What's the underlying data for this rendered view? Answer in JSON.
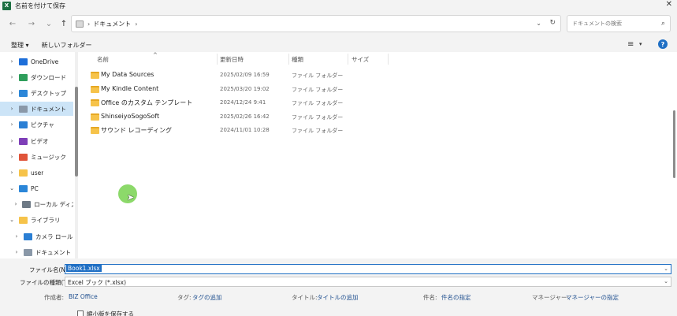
{
  "titlebar": {
    "app_icon": "X",
    "title": "名前を付けて保存",
    "close": "✕"
  },
  "navbar": {
    "back": "←",
    "forward": "→",
    "recent": "⌄",
    "up": "↑",
    "sep": "›",
    "crumb": "ドキュメント",
    "crumb_sep": "›",
    "dropdown": "⌄",
    "refresh": "↻",
    "search_placeholder": "ドキュメントの検索",
    "search_icon": "⌕"
  },
  "toolbar": {
    "organize": "整理 ▾",
    "new_folder": "新しいフォルダー",
    "view_icon": "≡",
    "view_drop": "▾",
    "help": "?"
  },
  "nav_pane": {
    "items": [
      {
        "chev": "›",
        "label": "OneDrive",
        "icon_color": "#1e6fd9"
      },
      {
        "chev": "›",
        "label": "ダウンロード",
        "icon_color": "#2e9e5b"
      },
      {
        "chev": "›",
        "label": "デスクトップ",
        "icon_color": "#2b86d8"
      },
      {
        "chev": "›",
        "label": "ドキュメント",
        "icon_color": "#8a98a8"
      },
      {
        "chev": "›",
        "label": "ピクチャ",
        "icon_color": "#2b7fd4"
      },
      {
        "chev": "›",
        "label": "ビデオ",
        "icon_color": "#7e3fb8"
      },
      {
        "chev": "›",
        "label": "ミュージック",
        "icon_color": "#e0543a"
      },
      {
        "chev": "›",
        "label": "user",
        "icon_color": "#f6c34a"
      },
      {
        "chev": "⌄",
        "label": "PC",
        "icon_color": "#2b86d8"
      },
      {
        "chev": "›",
        "label": "ローカル ディスク",
        "icon_color": "#6e7a86"
      },
      {
        "chev": "⌄",
        "label": "ライブラリ",
        "icon_color": "#f6c34a"
      },
      {
        "chev": "›",
        "label": "カメラ ロール",
        "icon_color": "#2b7fd4"
      },
      {
        "chev": "›",
        "label": "ドキュメント",
        "icon_color": "#8a98a8"
      }
    ]
  },
  "columns": {
    "name": "名前",
    "date": "更新日時",
    "type": "種類",
    "size": "サイズ",
    "sort_arrow": "^"
  },
  "files": [
    {
      "name": "My Data Sources",
      "date": "2025/02/09 16:59",
      "type": "ファイル フォルダー"
    },
    {
      "name": "My Kindle Content",
      "date": "2025/03/20 19:02",
      "type": "ファイル フォルダー"
    },
    {
      "name": "Office のカスタム テンプレート",
      "date": "2024/12/24 9:41",
      "type": "ファイル フォルダー"
    },
    {
      "name": "ShinseiyoSogoSoft",
      "date": "2025/02/26 16:42",
      "type": "ファイル フォルダー"
    },
    {
      "name": "サウンド レコーディング",
      "date": "2024/11/01 10:28",
      "type": "ファイル フォルダー"
    }
  ],
  "bottom": {
    "filename_label": "ファイル名(N):",
    "filename_value": "Book1.xlsx",
    "filetype_label": "ファイルの種類(T):",
    "filetype_value": "Excel ブック (*.xlsx)",
    "dropdown": "⌄",
    "author_label": "作成者:",
    "author_value": "BIZ Office",
    "tags_label": "タグ:",
    "tags_value": "タグの追加",
    "title_label": "タイトル:",
    "title_value": "タイトルの追加",
    "subject_label": "件名:",
    "subject_value": "件名の指定",
    "manager_label": "マネージャー:",
    "manager_value": "マネージャーの指定",
    "thumbnail_label": "縮小版を保存する"
  }
}
